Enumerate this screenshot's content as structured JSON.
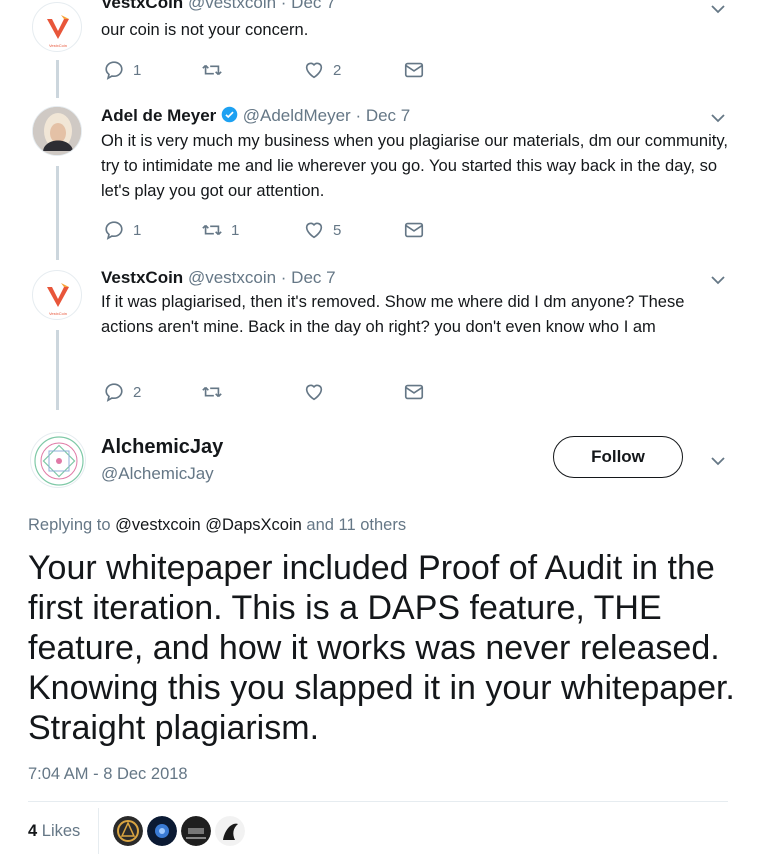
{
  "tweets": [
    {
      "name": "VestxCoin",
      "handle": "@vestxcoin",
      "date": "· Dec 7",
      "text": "our coin is not your concern.",
      "replies": "1",
      "retweets": "",
      "likes": "2"
    },
    {
      "name": "Adel de Meyer",
      "handle": "@AdeldMeyer",
      "date": "· Dec 7",
      "text": "Oh it is very much my business when you plagiarise our materials, dm our community, try to intimidate me and lie wherever you go. You started this way back in the day, so let's play you got our attention.",
      "replies": "1",
      "retweets": "1",
      "likes": "5"
    },
    {
      "name": "VestxCoin",
      "handle": "@vestxcoin",
      "date": "· Dec 7",
      "text": "If it was plagiarised, then it's removed. Show me where did I dm anyone? These actions aren't mine. Back in the day oh right? you don't even know who I am",
      "replies": "2",
      "retweets": "",
      "likes": ""
    }
  ],
  "main_tweet": {
    "name": "AlchemicJay",
    "handle": "@AlchemicJay",
    "follow_label": "Follow",
    "replying_prefix": "Replying to",
    "replying_users": "@vestxcoin @DapsXcoin",
    "replying_suffix": "and 11 others",
    "text": "Your whitepaper included Proof of Audit in the first iteration. This is a DAPS feature, THE feature, and how it works was never released. Knowing this you slapped it in your whitepaper. Straight plagiarism.",
    "timestamp": "7:04 AM - 8 Dec 2018",
    "likes_count": "4",
    "likes_label": "Likes"
  },
  "colors": {
    "accent": "#1da1f2",
    "muted": "#657786",
    "text": "#14171a",
    "verified": "#1da1f2"
  }
}
